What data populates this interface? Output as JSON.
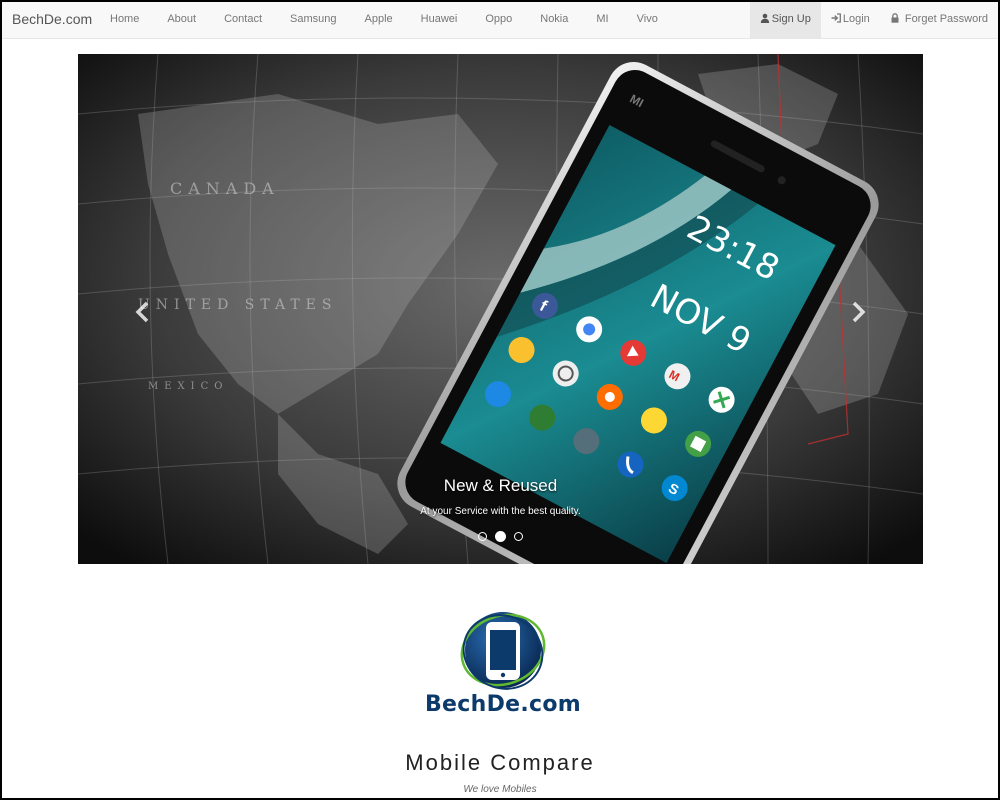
{
  "navbar": {
    "brand": "BechDe.com",
    "links": [
      "Home",
      "About",
      "Contact",
      "Samsung",
      "Apple",
      "Huawei",
      "Oppo",
      "Nokia",
      "MI",
      "Vivo"
    ],
    "right": {
      "signup": "Sign Up",
      "login": "Login",
      "forget": "Forget Password"
    }
  },
  "carousel": {
    "caption_title": "New & Reused",
    "caption_sub": "At your Service with the best quality.",
    "prev_icon": "chevron-left-icon",
    "next_icon": "chevron-right-icon",
    "slides": 3,
    "active_slide": 2,
    "phone": {
      "brand": "MI",
      "time": "23:18",
      "date": "NOV 9",
      "apps": [
        "Facebook",
        "Chrome",
        "PlayMemori...",
        "VSCO",
        "YouTube",
        "Music",
        "Gmail",
        "Gallery",
        "Maps",
        "Mi Home"
      ]
    },
    "map_labels": [
      "CANADA",
      "UNITED STATES",
      "MEXICO"
    ]
  },
  "logo": {
    "text": "BechDe.com",
    "icon": "smartphone-icon"
  },
  "main": {
    "title": "Mobile Compare",
    "tagline": "We love Mobiles"
  },
  "colors": {
    "navbar_bg": "#f8f8f8",
    "logo_blue": "#0c3a6b",
    "logo_green": "#5fb830",
    "screen_teal": "#1a7c85"
  }
}
